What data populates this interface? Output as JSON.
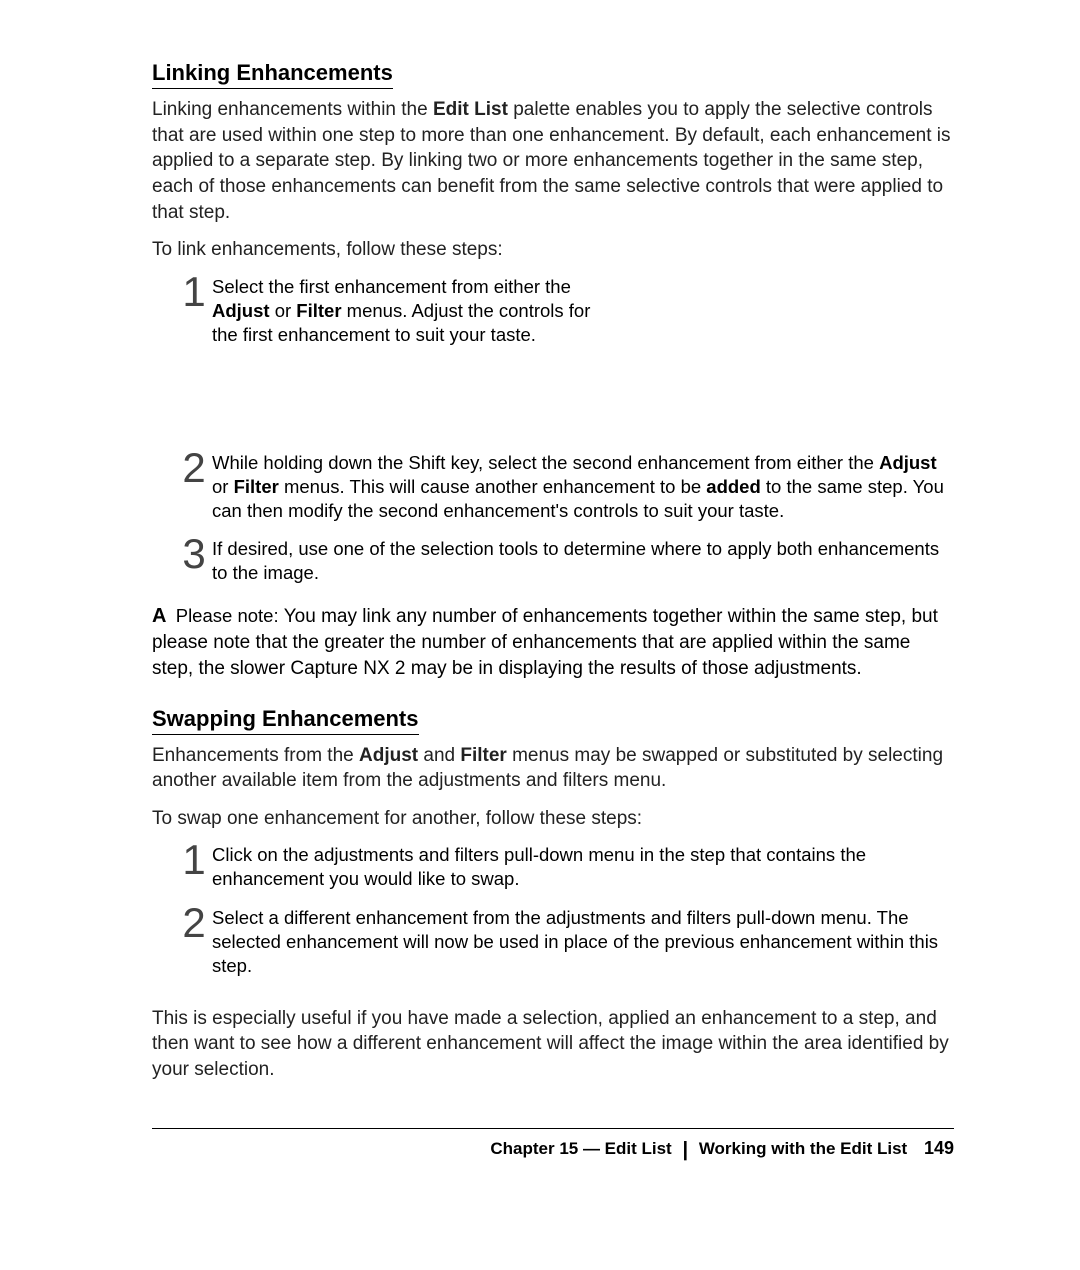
{
  "section1": {
    "heading": "Linking Enhancements",
    "para1_a": "Linking enhancements within the ",
    "para1_b": "Edit List",
    "para1_c": " palette enables you to apply the selective controls that are used within one step to more than one enhancement. By default, each enhancement is applied to a separate step. By linking two or more enhancements together in the same step, each of those enhancements can benefit from the same selective controls that were applied to that step.",
    "para2": "To link enhancements, follow these steps:",
    "steps": {
      "n1": "1",
      "s1_a": "Select the first enhancement from either the ",
      "s1_b": "Adjust",
      "s1_c": " or ",
      "s1_d": "Filter",
      "s1_e": " menus. Adjust the controls for the first enhancement to suit your taste.",
      "n2": "2",
      "s2_a": "While holding down the Shift key, select the second enhancement from either the ",
      "s2_b": "Adjust",
      "s2_c": " or ",
      "s2_d": "Filter",
      "s2_e": " menus. This will cause another enhancement to be ",
      "s2_f": "added",
      "s2_g": " to the same step. You can then modify the second enhancement's controls to suit your taste.",
      "n3": "3",
      "s3": "If desired, use one of the selection tools to determine where to apply both enhancements to the image."
    },
    "note_icon": "A",
    "note_lead": "Please note: ",
    "note_body": "You may link any number of enhancements together within the same step, but please note that the greater the number of enhancements that are applied within the same step, the slower Capture NX 2 may be in displaying the results of those adjustments."
  },
  "section2": {
    "heading": "Swapping Enhancements",
    "para1_a": "Enhancements from the ",
    "para1_b": "Adjust",
    "para1_c": " and ",
    "para1_d": "Filter",
    "para1_e": " menus may be swapped or substituted by selecting another available item from the adjustments and filters menu.",
    "para2": "To swap one enhancement for another, follow these steps:",
    "steps": {
      "n1": "1",
      "s1": "Click on the adjustments and filters pull-down menu in the step that contains the enhancement you would like to swap.",
      "n2": "2",
      "s2": "Select a different enhancement from the adjustments and filters pull-down menu. The selected enhancement will now be used in place of the previous enhancement within this step."
    },
    "para3": "This is especially useful if you have made a selection, applied an enhancement to a step, and then want to see how a different enhancement will affect the image within the area identified by your selection."
  },
  "footer": {
    "chapter": "Chapter 15 — Edit List",
    "section": "Working with the Edit List",
    "page": "149"
  }
}
